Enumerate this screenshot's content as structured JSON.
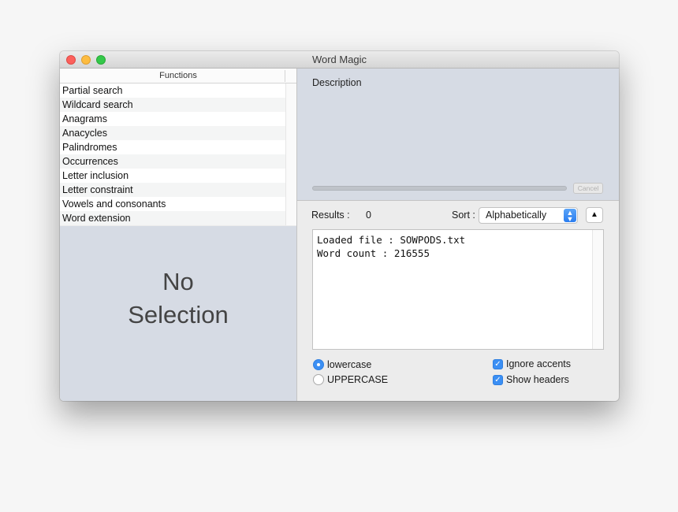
{
  "window": {
    "title": "Word Magic"
  },
  "functions": {
    "header": "Functions",
    "items": [
      "Partial search",
      "Wildcard search",
      "Anagrams",
      "Anacycles",
      "Palindromes",
      "Occurrences",
      "Letter inclusion",
      "Letter constraint",
      "Vowels and consonants",
      "Word extension"
    ]
  },
  "placeholder": {
    "line1": "No",
    "line2": "Selection"
  },
  "description": {
    "label": "Description",
    "cancel_label": "Cancel",
    "progress": 0
  },
  "results": {
    "label": "Results :",
    "count": "0",
    "sort_label": "Sort :",
    "sort_value": "Alphabetically",
    "sort_direction_glyph": "▲"
  },
  "output": {
    "lines": [
      "Loaded file : SOWPODS.txt",
      "Word count : 216555"
    ]
  },
  "options": {
    "case": [
      {
        "label": "lowercase",
        "selected": true
      },
      {
        "label": "UPPERCASE",
        "selected": false
      }
    ],
    "checks": [
      {
        "label": "Ignore accents",
        "checked": true
      },
      {
        "label": "Show headers",
        "checked": true
      }
    ]
  },
  "colors": {
    "accent": "#3b8ff4",
    "panel": "#d6dbe4"
  }
}
